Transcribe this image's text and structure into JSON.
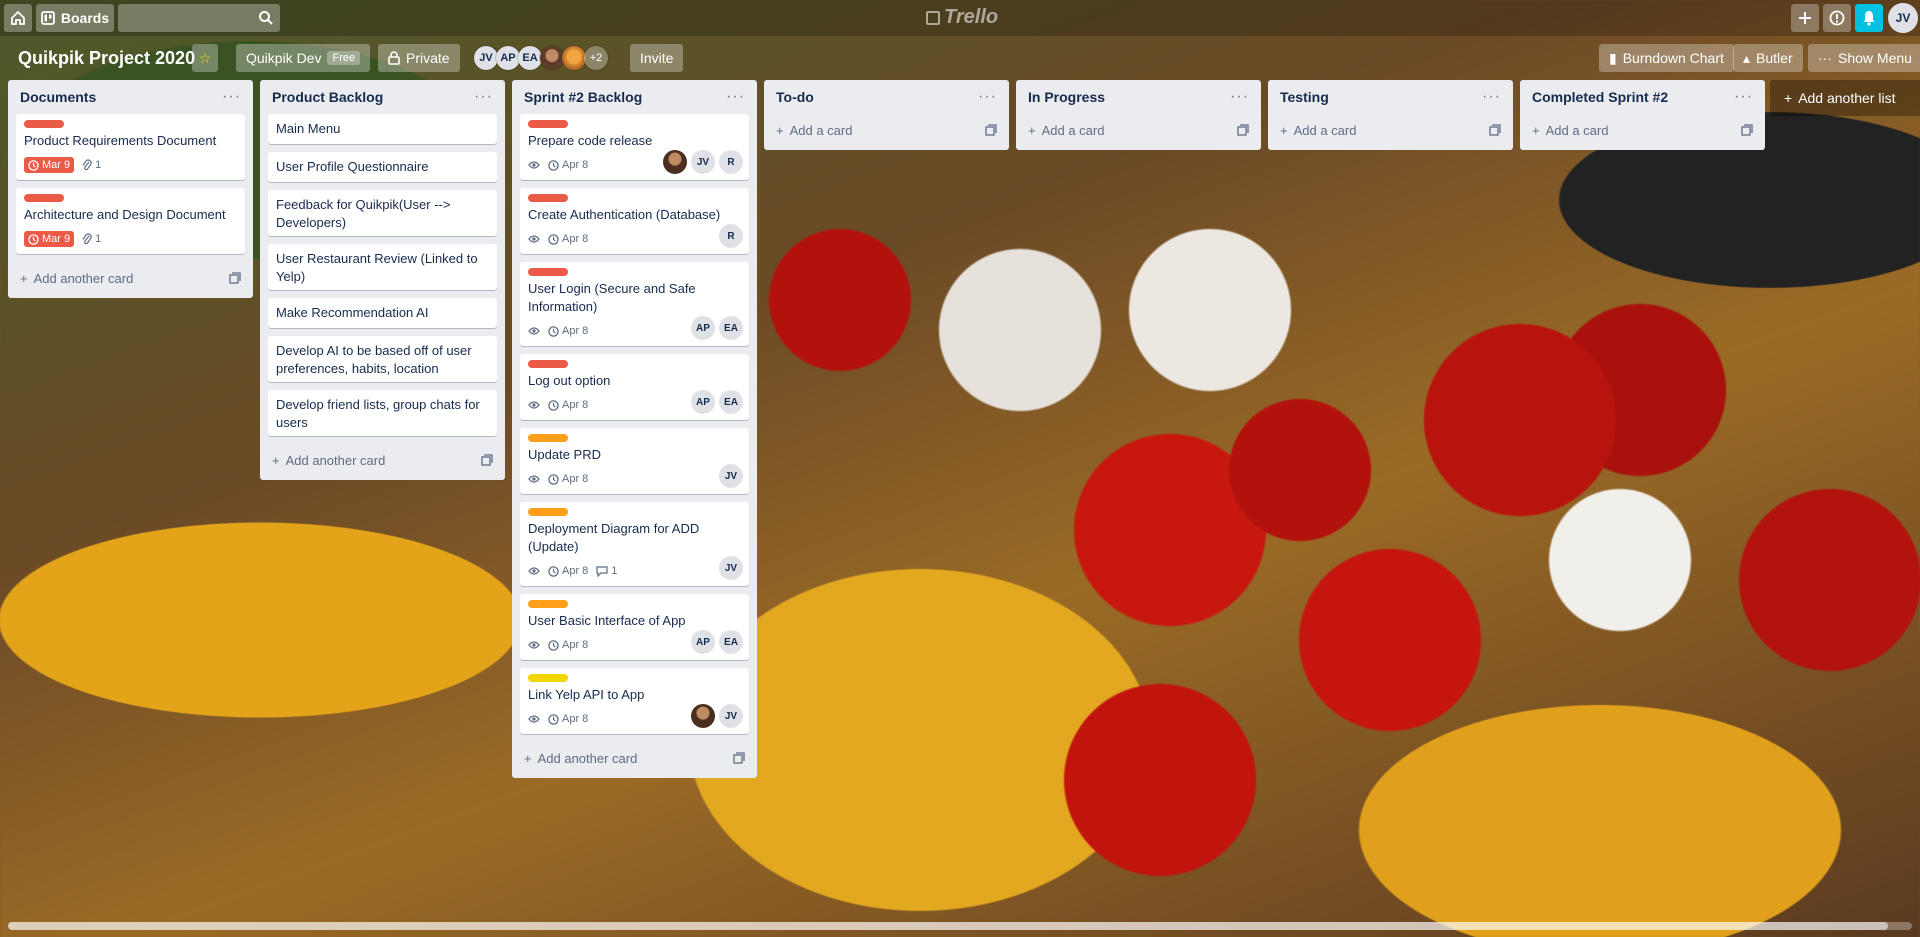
{
  "app": {
    "logo_text": "Trello"
  },
  "topbar": {
    "boards_label": "Boards",
    "user_initials": "JV"
  },
  "board": {
    "title": "Quikpik Project 2020",
    "team_name": "Quikpik Dev",
    "team_badge": "Free",
    "visibility": "Private",
    "invite_label": "Invite",
    "burndown_label": "Burndown Chart",
    "butler_label": "Butler",
    "show_menu_label": "Show Menu",
    "members": [
      "JV",
      "AP",
      "EA"
    ],
    "more_members": "+2"
  },
  "add_card_label": "Add a card",
  "add_another_card_label": "Add another card",
  "add_another_list_label": "Add another list",
  "label_colors": {
    "red": "#eb5a46",
    "orange": "#ff9f1a",
    "yellow": "#f2d600"
  },
  "lists": [
    {
      "title": "Documents",
      "cards": [
        {
          "title": "Product Requirements Document",
          "label": "red",
          "due": "Mar 9",
          "attachments": "1"
        },
        {
          "title": "Architecture and Design Document",
          "label": "red",
          "due": "Mar 9",
          "attachments": "1"
        }
      ]
    },
    {
      "title": "Product Backlog",
      "cards": [
        {
          "title": "Main Menu"
        },
        {
          "title": "User Profile Questionnaire"
        },
        {
          "title": "Feedback for Quikpik(User --> Developers)"
        },
        {
          "title": "User Restaurant Review (Linked to Yelp)"
        },
        {
          "title": "Make Recommendation AI"
        },
        {
          "title": "Develop AI to be based off of user preferences, habits, location"
        },
        {
          "title": "Develop friend lists, group chats for users"
        }
      ]
    },
    {
      "title": "Sprint #2 Backlog",
      "cards": [
        {
          "title": "Prepare code release",
          "label": "red",
          "due": "Apr 8",
          "members": [
            "photo",
            "JV",
            "R"
          ]
        },
        {
          "title": "Create Authentication (Database)",
          "label": "red",
          "due": "Apr 8",
          "members": [
            "R"
          ]
        },
        {
          "title": "User Login (Secure and Safe Information)",
          "label": "red",
          "due": "Apr 8",
          "members": [
            "AP",
            "EA"
          ]
        },
        {
          "title": "Log out option",
          "label": "red",
          "due": "Apr 8",
          "members": [
            "AP",
            "EA"
          ]
        },
        {
          "title": "Update PRD",
          "label": "orange",
          "due": "Apr 8",
          "members": [
            "JV"
          ]
        },
        {
          "title": "Deployment Diagram for ADD (Update)",
          "label": "orange",
          "due": "Apr 8",
          "comments": "1",
          "members": [
            "JV"
          ]
        },
        {
          "title": "User Basic Interface of App",
          "label": "orange",
          "due": "Apr 8",
          "members": [
            "AP",
            "EA"
          ]
        },
        {
          "title": "Link Yelp API to App",
          "label": "yellow",
          "due": "Apr 8",
          "members": [
            "photo",
            "JV"
          ]
        }
      ]
    },
    {
      "title": "To-do",
      "cards": []
    },
    {
      "title": "In Progress",
      "cards": []
    },
    {
      "title": "Testing",
      "cards": []
    },
    {
      "title": "Completed Sprint #2",
      "cards": []
    }
  ]
}
